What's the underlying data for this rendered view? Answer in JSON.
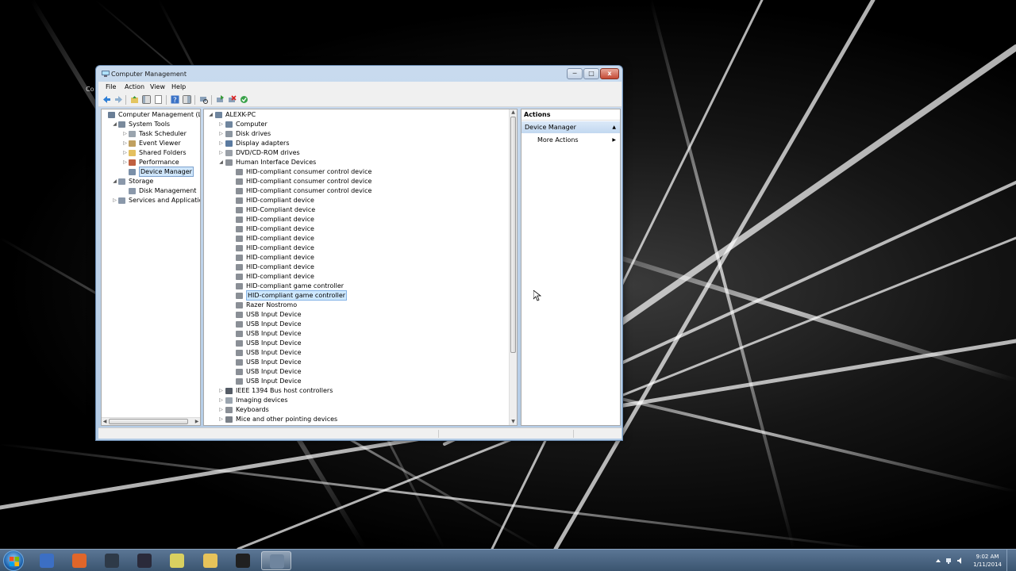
{
  "desktop": {
    "partial_label": "Co"
  },
  "window": {
    "title": "Computer Management",
    "controls": {
      "minimize": "─",
      "maximize": "□",
      "close": "x"
    }
  },
  "menu": [
    "File",
    "Action",
    "View",
    "Help"
  ],
  "left_tree": [
    {
      "label": "Computer Management (Local",
      "level": 0,
      "arrow": "",
      "icon": "computer-management-icon",
      "color": "#6a7e96"
    },
    {
      "label": "System Tools",
      "level": 1,
      "arrow": "◢",
      "icon": "system-tools-icon",
      "color": "#7a8a9c"
    },
    {
      "label": "Task Scheduler",
      "level": 2,
      "arrow": "▷",
      "icon": "clock-icon",
      "color": "#9aa4ae"
    },
    {
      "label": "Event Viewer",
      "level": 2,
      "arrow": "▷",
      "icon": "event-viewer-icon",
      "color": "#c0a060"
    },
    {
      "label": "Shared Folders",
      "level": 2,
      "arrow": "▷",
      "icon": "shared-folder-icon",
      "color": "#e4c060"
    },
    {
      "label": "Performance",
      "level": 2,
      "arrow": "▷",
      "icon": "performance-icon",
      "color": "#c06040"
    },
    {
      "label": "Device Manager",
      "level": 2,
      "arrow": "",
      "icon": "device-manager-icon",
      "color": "#7a8fa8",
      "selected": true
    },
    {
      "label": "Storage",
      "level": 1,
      "arrow": "◢",
      "icon": "storage-icon",
      "color": "#8a98aa"
    },
    {
      "label": "Disk Management",
      "level": 2,
      "arrow": "",
      "icon": "disk-icon",
      "color": "#8a98aa"
    },
    {
      "label": "Services and Applications",
      "level": 1,
      "arrow": "▷",
      "icon": "services-icon",
      "color": "#8a98aa"
    }
  ],
  "device_tree": [
    {
      "label": "ALEXK-PC",
      "level": 0,
      "arrow": "◢",
      "icon": "computer-icon",
      "color": "#6f859e"
    },
    {
      "label": "Computer",
      "level": 1,
      "arrow": "▷",
      "icon": "computer-icon",
      "color": "#6f859e"
    },
    {
      "label": "Disk drives",
      "level": 1,
      "arrow": "▷",
      "icon": "disk-drive-icon",
      "color": "#8c96a0"
    },
    {
      "label": "Display adapters",
      "level": 1,
      "arrow": "▷",
      "icon": "display-adapter-icon",
      "color": "#5a7aa0"
    },
    {
      "label": "DVD/CD-ROM drives",
      "level": 1,
      "arrow": "▷",
      "icon": "dvd-drive-icon",
      "color": "#9aa0a8"
    },
    {
      "label": "Human Interface Devices",
      "level": 1,
      "arrow": "◢",
      "icon": "hid-icon",
      "color": "#8a8f96"
    },
    {
      "label": "HID-compliant consumer control device",
      "level": 2,
      "arrow": "",
      "icon": "hid-icon",
      "color": "#8a8f96"
    },
    {
      "label": "HID-compliant consumer control device",
      "level": 2,
      "arrow": "",
      "icon": "hid-icon",
      "color": "#8a8f96"
    },
    {
      "label": "HID-compliant consumer control device",
      "level": 2,
      "arrow": "",
      "icon": "hid-icon",
      "color": "#8a8f96"
    },
    {
      "label": "HID-compliant device",
      "level": 2,
      "arrow": "",
      "icon": "hid-icon",
      "color": "#8a8f96"
    },
    {
      "label": "HID-Compliant device",
      "level": 2,
      "arrow": "",
      "icon": "hid-icon",
      "color": "#8a8f96"
    },
    {
      "label": "HID-compliant device",
      "level": 2,
      "arrow": "",
      "icon": "hid-icon",
      "color": "#8a8f96"
    },
    {
      "label": "HID-compliant device",
      "level": 2,
      "arrow": "",
      "icon": "hid-icon",
      "color": "#8a8f96"
    },
    {
      "label": "HID-compliant device",
      "level": 2,
      "arrow": "",
      "icon": "hid-icon",
      "color": "#8a8f96"
    },
    {
      "label": "HID-compliant device",
      "level": 2,
      "arrow": "",
      "icon": "hid-icon",
      "color": "#8a8f96"
    },
    {
      "label": "HID-compliant device",
      "level": 2,
      "arrow": "",
      "icon": "hid-icon",
      "color": "#8a8f96"
    },
    {
      "label": "HID-compliant device",
      "level": 2,
      "arrow": "",
      "icon": "hid-icon",
      "color": "#8a8f96"
    },
    {
      "label": "HID-compliant device",
      "level": 2,
      "arrow": "",
      "icon": "hid-icon",
      "color": "#8a8f96"
    },
    {
      "label": "HID-compliant game controller",
      "level": 2,
      "arrow": "",
      "icon": "hid-icon",
      "color": "#8a8f96"
    },
    {
      "label": "HID-compliant game controller",
      "level": 2,
      "arrow": "",
      "icon": "hid-icon",
      "color": "#8a8f96",
      "highlighted": true
    },
    {
      "label": "Razer Nostromo",
      "level": 2,
      "arrow": "",
      "icon": "hid-icon",
      "color": "#8a8f96"
    },
    {
      "label": "USB Input Device",
      "level": 2,
      "arrow": "",
      "icon": "hid-icon",
      "color": "#8a8f96"
    },
    {
      "label": "USB Input Device",
      "level": 2,
      "arrow": "",
      "icon": "hid-icon",
      "color": "#8a8f96"
    },
    {
      "label": "USB Input Device",
      "level": 2,
      "arrow": "",
      "icon": "hid-icon",
      "color": "#8a8f96"
    },
    {
      "label": "USB Input Device",
      "level": 2,
      "arrow": "",
      "icon": "hid-icon",
      "color": "#8a8f96"
    },
    {
      "label": "USB Input Device",
      "level": 2,
      "arrow": "",
      "icon": "hid-icon",
      "color": "#8a8f96"
    },
    {
      "label": "USB Input Device",
      "level": 2,
      "arrow": "",
      "icon": "hid-icon",
      "color": "#8a8f96"
    },
    {
      "label": "USB Input Device",
      "level": 2,
      "arrow": "",
      "icon": "hid-icon",
      "color": "#8a8f96"
    },
    {
      "label": "USB Input Device",
      "level": 2,
      "arrow": "",
      "icon": "hid-icon",
      "color": "#8a8f96"
    },
    {
      "label": "IEEE 1394 Bus host controllers",
      "level": 1,
      "arrow": "▷",
      "icon": "ieee1394-icon",
      "color": "#555c66"
    },
    {
      "label": "Imaging devices",
      "level": 1,
      "arrow": "▷",
      "icon": "imaging-device-icon",
      "color": "#9aa4ae"
    },
    {
      "label": "Keyboards",
      "level": 1,
      "arrow": "▷",
      "icon": "keyboard-icon",
      "color": "#8a8f96"
    },
    {
      "label": "Mice and other pointing devices",
      "level": 1,
      "arrow": "▷",
      "icon": "mouse-icon",
      "color": "#7a8088"
    }
  ],
  "actions": {
    "header": "Actions",
    "section": "Device Manager",
    "section_chevron": "▲",
    "item": "More Actions",
    "item_chevron": "▶"
  },
  "taskbar": {
    "apps": [
      {
        "name": "taskbar-app-remote",
        "color": "#3c6fc4"
      },
      {
        "name": "taskbar-app-firefox",
        "color": "#e0662a"
      },
      {
        "name": "taskbar-app-monitor",
        "color": "#2e3a48"
      },
      {
        "name": "taskbar-app-visual-studio",
        "color": "#2a2a3a"
      },
      {
        "name": "taskbar-app-notes",
        "color": "#d9d060"
      },
      {
        "name": "taskbar-app-explorer",
        "color": "#e7c35a"
      },
      {
        "name": "taskbar-app-obs",
        "color": "#202020"
      },
      {
        "name": "taskbar-app-computer-management",
        "color": "#6f859e",
        "active": true
      }
    ],
    "time": "9:02 AM",
    "date": "1/11/2014"
  }
}
